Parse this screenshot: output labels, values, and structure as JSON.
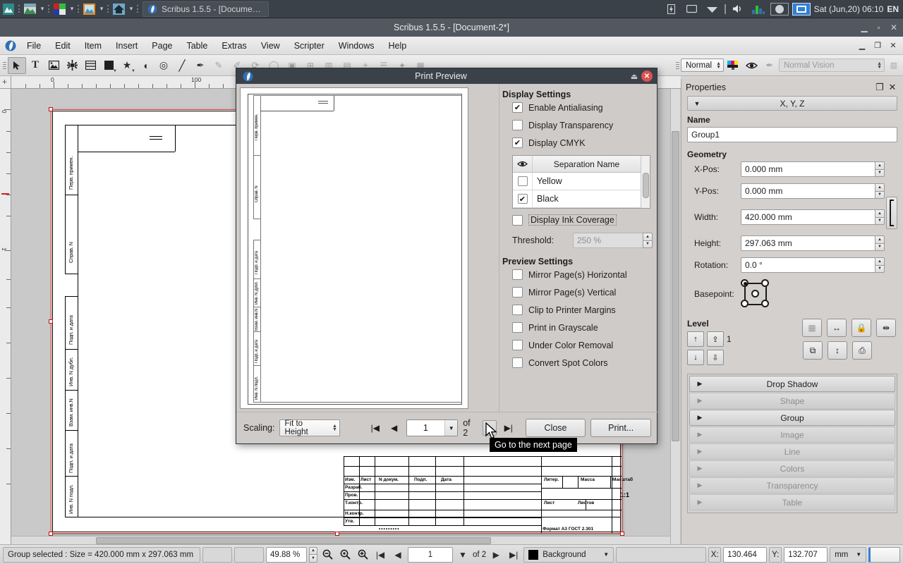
{
  "taskbar": {
    "icons": [
      "menu-icon",
      "desktop-icon",
      "colors-icon",
      "display-icon",
      "home-icon"
    ],
    "task_title": "Scribus 1.5.5 - [Docume…",
    "tray": [
      "battery-icon",
      "display-icon",
      "wifi-icon",
      "volume-icon",
      "audio-mixer-icon"
    ],
    "clock": "Sat (Jun,20) 06:10",
    "language": "EN"
  },
  "window": {
    "title": "Scribus 1.5.5 - [Document-2*]"
  },
  "menubar": {
    "items": [
      "File",
      "Edit",
      "Item",
      "Insert",
      "Page",
      "Table",
      "Extras",
      "View",
      "Scripter",
      "Windows",
      "Help"
    ]
  },
  "toolbar": {
    "tools": [
      {
        "name": "select-tool",
        "glyph": "➤"
      },
      {
        "name": "text-frame-tool",
        "glyph": "T"
      },
      {
        "name": "image-frame-tool",
        "glyph": "❑"
      },
      {
        "name": "render-frame-tool",
        "glyph": "☀"
      },
      {
        "name": "table-tool",
        "glyph": "☰"
      },
      {
        "name": "shape-tool",
        "glyph": "■"
      },
      {
        "name": "polygon-tool",
        "glyph": "★"
      },
      {
        "name": "arc-tool",
        "glyph": "◖"
      },
      {
        "name": "spiral-tool",
        "glyph": "◎"
      },
      {
        "name": "line-tool",
        "glyph": "/"
      },
      {
        "name": "bezier-tool",
        "glyph": "✒"
      }
    ],
    "preview_mode": "Normal",
    "vision_mode": "Normal Vision"
  },
  "rulers": {
    "h_labels": [
      "0",
      "100"
    ],
    "v_labels": [
      "0",
      "1"
    ],
    "unit": "mm"
  },
  "drawing": {
    "side_labels": [
      "Перв. примен.",
      "Справ. N",
      "Подп. и дата",
      "Инв. N дубл.",
      "Взам. инв.N",
      "Подп. и дата",
      "Инв. N подл."
    ],
    "titleblock": {
      "col_headers": [
        "Изм.",
        "Лист",
        "N докум.",
        "Подп.",
        "Дата"
      ],
      "rows": [
        "Разраб.",
        "Пров.",
        "Т.контр.",
        "Н.контр.",
        "Утв."
      ],
      "right_headers": [
        "Литер.",
        "Масса",
        "Масштаб"
      ],
      "scale": "1:1",
      "sheet_labels": [
        "Лист",
        "Листов"
      ],
      "format": "Формат  A3 ГОСТ  2.301"
    }
  },
  "dialog": {
    "title": "Print Preview",
    "display_settings": {
      "heading": "Display Settings",
      "options": [
        {
          "label": "Enable Antialiasing",
          "checked": true
        },
        {
          "label": "Display Transparency",
          "checked": false
        },
        {
          "label": "Display CMYK",
          "checked": true
        }
      ],
      "separation_header": "Separation Name",
      "separations": [
        {
          "name": "Yellow",
          "checked": false
        },
        {
          "name": "Black",
          "checked": true
        }
      ],
      "ink_coverage_label": "Display Ink Coverage",
      "ink_coverage_checked": false,
      "threshold_label": "Threshold:",
      "threshold_value": "250 %"
    },
    "preview_settings": {
      "heading": "Preview Settings",
      "options": [
        {
          "label": "Mirror Page(s) Horizontal",
          "checked": false
        },
        {
          "label": "Mirror Page(s) Vertical",
          "checked": false
        },
        {
          "label": "Clip to Printer Margins",
          "checked": false
        },
        {
          "label": "Print in Grayscale",
          "checked": false
        },
        {
          "label": "Under Color Removal",
          "checked": false
        },
        {
          "label": "Convert Spot Colors",
          "checked": false
        }
      ]
    },
    "footer": {
      "scaling_label": "Scaling:",
      "scaling_value": "Fit to Height",
      "page_value": "1",
      "page_of": "of 2",
      "close_label": "Close",
      "print_label": "Print..."
    },
    "tooltip": "Go to the next page"
  },
  "properties": {
    "title": "Properties",
    "xyz_tab": "X, Y, Z",
    "name_label": "Name",
    "name_value": "Group1",
    "geometry_label": "Geometry",
    "fields": [
      {
        "label": "X-Pos:",
        "value": "0.000 mm"
      },
      {
        "label": "Y-Pos:",
        "value": "0.000 mm"
      },
      {
        "label": "Width:",
        "value": "420.000 mm"
      },
      {
        "label": "Height:",
        "value": "297.063 mm"
      },
      {
        "label": "Rotation:",
        "value": "0.0 °"
      }
    ],
    "basepoint_label": "Basepoint:",
    "level_label": "Level",
    "level_value": "1",
    "sections": [
      {
        "label": "Drop Shadow",
        "enabled": true
      },
      {
        "label": "Shape",
        "enabled": false
      },
      {
        "label": "Group",
        "enabled": true
      },
      {
        "label": "Image",
        "enabled": false
      },
      {
        "label": "Line",
        "enabled": false
      },
      {
        "label": "Colors",
        "enabled": false
      },
      {
        "label": "Transparency",
        "enabled": false
      },
      {
        "label": "Table",
        "enabled": false
      }
    ]
  },
  "statusbar": {
    "selection": "Group selected : Size = 420.000 mm x 297.063 mm",
    "zoom": "49.88 %",
    "page_value": "1",
    "page_of": "of 2",
    "layer": "Background",
    "x_label": "X:",
    "x_value": "130.464",
    "y_label": "Y:",
    "y_value": "132.707",
    "unit": "mm"
  },
  "colors": {
    "taskbar_bg": "#3b4148",
    "titlebar_bg": "#52585f",
    "accent_blue": "#2f7fd4",
    "close_red": "#d9534f",
    "panel_bg": "#d4d0cd",
    "selection_red": "#e03a3a"
  }
}
